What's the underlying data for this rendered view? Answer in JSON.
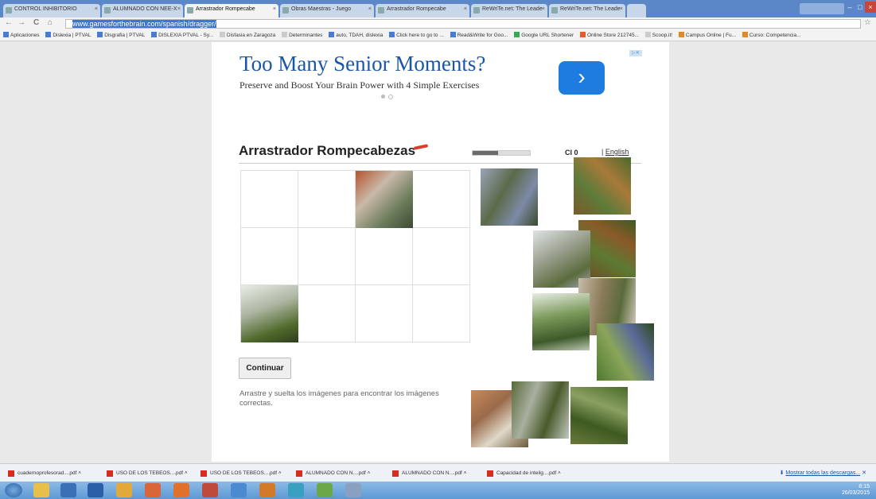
{
  "browser": {
    "tabs": [
      {
        "label": "CONTROL INHIBITORIO"
      },
      {
        "label": "ALUMNADO CON NEE-X"
      },
      {
        "label": "Arrastrador Rompecabe"
      },
      {
        "label": "Obras Maestras - Juego"
      },
      {
        "label": "Arrastrador Rompecabe"
      },
      {
        "label": "ReWriTe.net: The Leade"
      },
      {
        "label": "ReWriTe.net: The Leade"
      }
    ],
    "url": "www.gamesforthebrain.com/spanish/dragger/",
    "bookmarks": [
      "Aplicaciones",
      "Dislexia | PTVAL",
      "Disgrafia | PTVAL",
      "DISLEXIA PTVAL - Sy...",
      "Disfasia en Zaragoza",
      "Determinantes",
      "auto, TDAH, dislexia",
      "Click here to go to ...",
      "Read&Write for Goo...",
      "Google URL Shortener",
      "Online Store 212745...",
      "Scoop.it!",
      "Campus Online | Fu...",
      "Curso: Competencia..."
    ]
  },
  "ad": {
    "title": "Too Many Senior Moments?",
    "subtitle": "Preserve and Boost Your Brain Power with 4 Simple Exercises",
    "arrow": "›",
    "badge": "▷✕"
  },
  "game": {
    "title": "Arrastrador Rompecabezas",
    "score": "Cl 0",
    "language_link": "English",
    "language_sep": "|",
    "progress": 0.45,
    "continue_label": "Continuar",
    "instructions": "Arrastre y suelta los imágenes para encontrar los imágenes correctas."
  },
  "downloads": {
    "items": [
      "cuadernoprofesorad....pdf",
      "USO DE LOS TEBEOS....pdf",
      "USO DE LOS TEBEOS....pdf",
      "ALUMNADO CON N....pdf",
      "ALUMNADO CON N....pdf",
      "Capacidad de inteilg....pdf"
    ],
    "show_all": "Mostrar todas las descargas..."
  },
  "taskbar": {
    "time": "8:15",
    "date": "26/03/2015"
  },
  "colors": {
    "ad_blue": "#1e7be0",
    "title_blue": "#1a56a6",
    "accent_red": "#d9402c"
  }
}
